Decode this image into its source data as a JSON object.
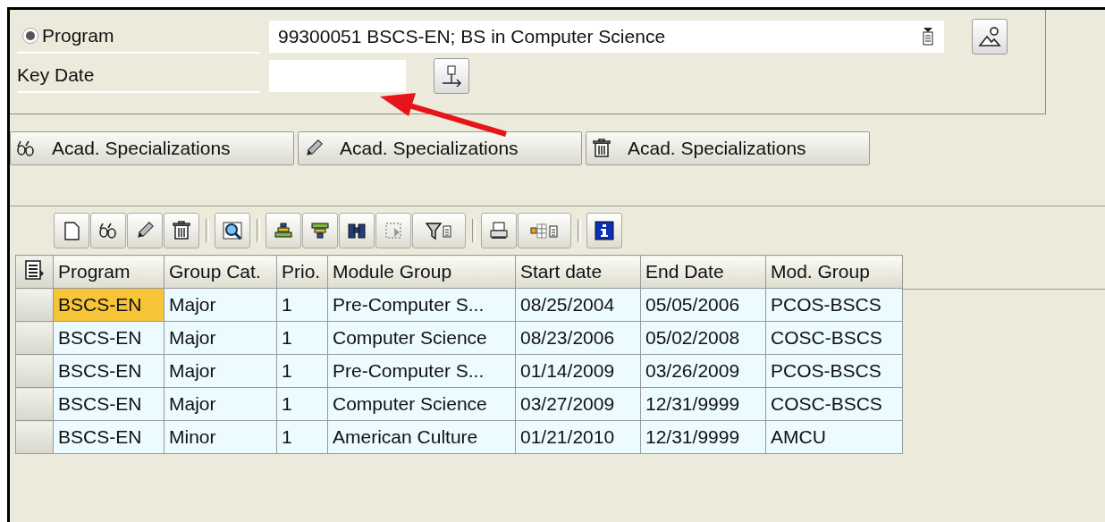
{
  "selection": {
    "fields": [
      {
        "kind": "radio",
        "label": "Program",
        "selected": true,
        "value": "99300051 BSCS-EN; BS in Computer Science",
        "dropdown": true
      },
      {
        "kind": "plain",
        "label": "Key Date"
      }
    ]
  },
  "action_buttons": [
    {
      "label": "Acad. Specializations"
    },
    {
      "label": "Acad. Specializations"
    },
    {
      "label": "Acad. Specializations"
    }
  ],
  "table": {
    "columns": [
      "Program",
      "Group Cat.",
      "Prio.",
      "Module Group",
      "Start date",
      "End Date",
      "Mod. Group"
    ],
    "rows": [
      {
        "selected": true,
        "cells": [
          "BSCS-EN",
          "Major",
          "1",
          "Pre-Computer S...",
          "08/25/2004",
          "05/05/2006",
          "PCOS-BSCS"
        ]
      },
      {
        "selected": false,
        "cells": [
          "BSCS-EN",
          "Major",
          "1",
          "Computer Science",
          "08/23/2006",
          "05/02/2008",
          "COSC-BSCS"
        ]
      },
      {
        "selected": false,
        "cells": [
          "BSCS-EN",
          "Major",
          "1",
          "Pre-Computer S...",
          "01/14/2009",
          "03/26/2009",
          "PCOS-BSCS"
        ]
      },
      {
        "selected": false,
        "cells": [
          "BSCS-EN",
          "Major",
          "1",
          "Computer Science",
          "03/27/2009",
          "12/31/9999",
          "COSC-BSCS"
        ]
      },
      {
        "selected": false,
        "cells": [
          "BSCS-EN",
          "Minor",
          "1",
          "American Culture",
          "01/21/2010",
          "12/31/9999",
          "AMCU"
        ]
      }
    ]
  }
}
